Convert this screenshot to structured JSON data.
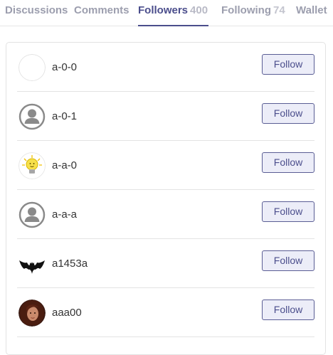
{
  "tabs": [
    {
      "label": "Discussions",
      "count": ""
    },
    {
      "label": "Comments",
      "count": ""
    },
    {
      "label": "Followers",
      "count": "400"
    },
    {
      "label": "Following",
      "count": "74"
    },
    {
      "label": "Wallet",
      "count": ""
    }
  ],
  "active_tab": "Followers",
  "followers": [
    {
      "name": "a-0-0",
      "avatar": "blank-avatar-icon",
      "button": "Follow"
    },
    {
      "name": "a-0-1",
      "avatar": "default-user-avatar-icon",
      "button": "Follow"
    },
    {
      "name": "a-a-0",
      "avatar": "lightbulb-avatar-icon",
      "button": "Follow"
    },
    {
      "name": "a-a-a",
      "avatar": "default-user-avatar-icon",
      "button": "Follow"
    },
    {
      "name": "a1453a",
      "avatar": "bat-avatar-icon",
      "button": "Follow"
    },
    {
      "name": "aaa00",
      "avatar": "portrait-avatar-icon",
      "button": "Follow"
    }
  ],
  "colors": {
    "accent": "#4b4e8c",
    "tab_inactive": "#9c9eae",
    "button_bg": "#ecedf8",
    "divider": "#e3e3e3"
  }
}
